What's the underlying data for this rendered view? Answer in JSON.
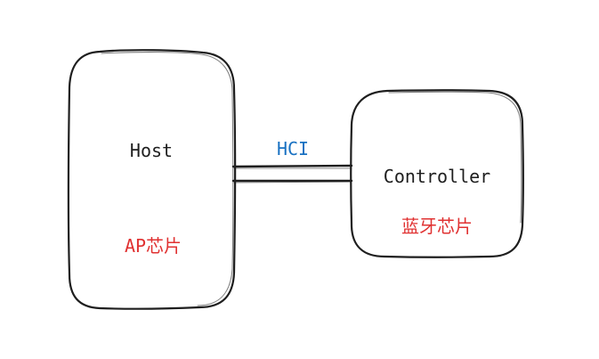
{
  "diagram": {
    "nodes": [
      {
        "id": "host",
        "title": "Host",
        "subtitle": "AP芯片"
      },
      {
        "id": "controller",
        "title": "Controller",
        "subtitle": "蓝牙芯片"
      }
    ],
    "edges": [
      {
        "from": "host",
        "to": "controller",
        "label": "HCI",
        "style": "double-line"
      }
    ]
  },
  "colors": {
    "stroke": "#1e1e1e",
    "title": "#1e1e1e",
    "subtitle": "#e03131",
    "edge_label": "#1971c2",
    "background": "#ffffff"
  }
}
